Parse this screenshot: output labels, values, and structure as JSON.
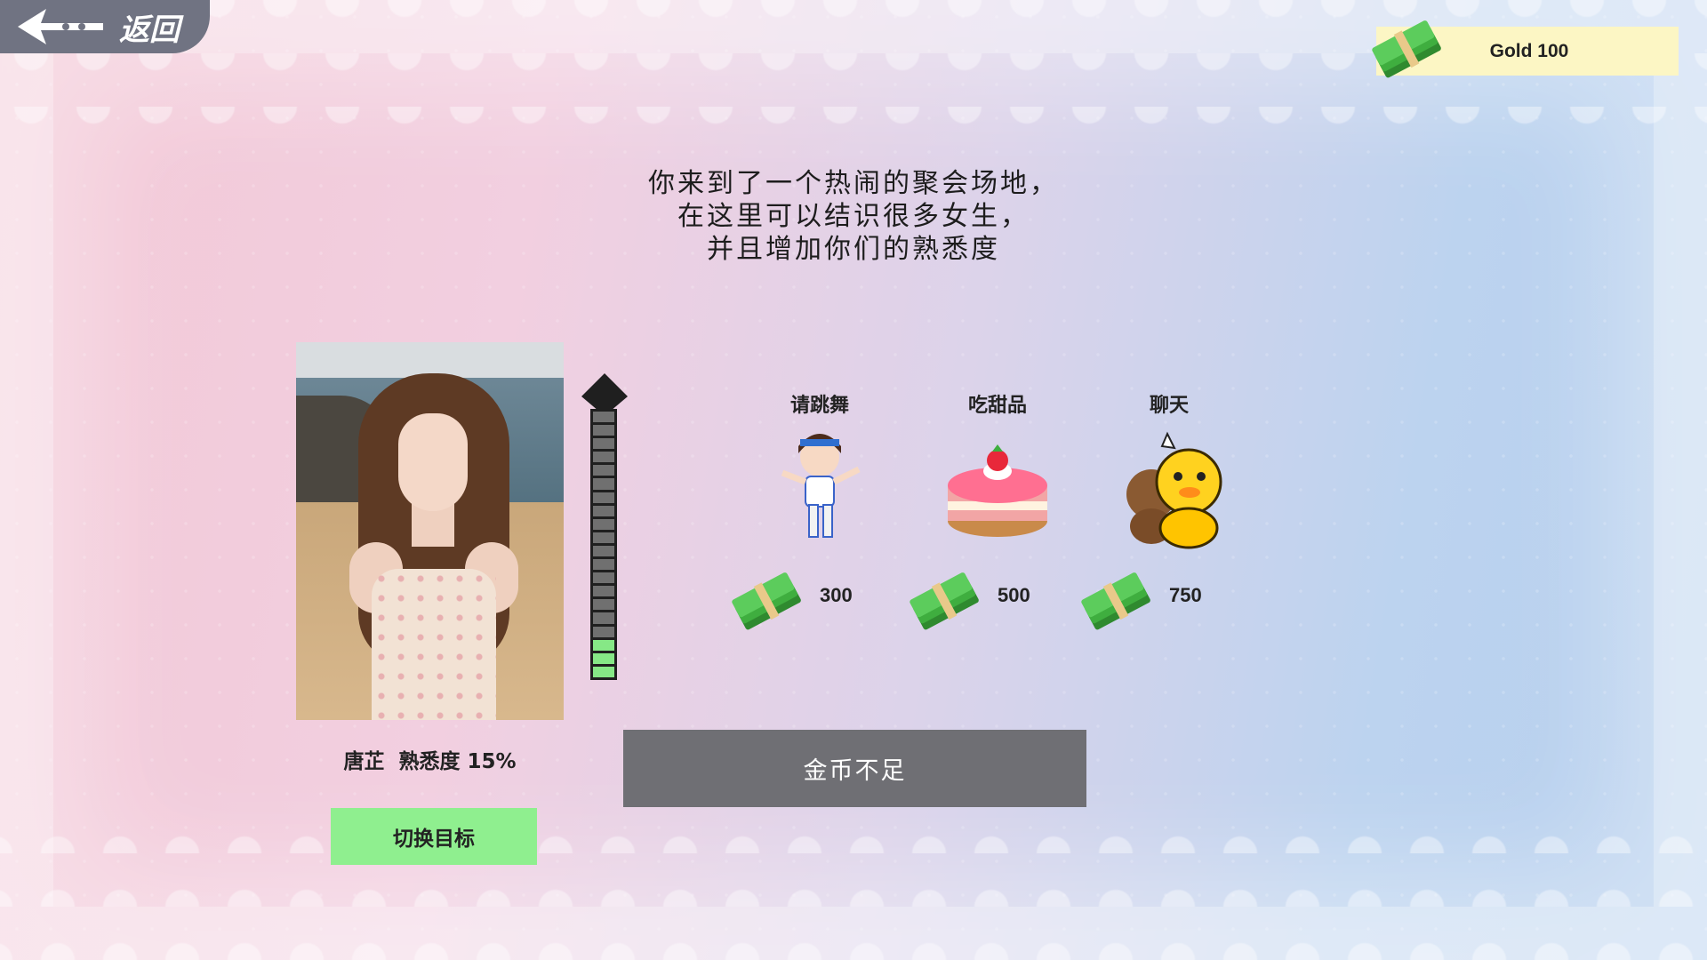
{
  "nav": {
    "back_label": "返回",
    "back_icon": "arrow-left-icon"
  },
  "currency": {
    "label": "Gold 100",
    "icon": "cash-stack-icon"
  },
  "intro_lines": [
    "你来到了一个热闹的聚会场地，",
    "在这里可以结识很多女生，",
    "并且增加你们的熟悉度"
  ],
  "target": {
    "name": "唐芷",
    "familiarity_label": "熟悉度 15%",
    "familiarity_value": 0.15,
    "switch_label": "切换目标"
  },
  "activities": [
    {
      "title": "请跳舞",
      "price": "300",
      "icon": "dancing-girl-icon"
    },
    {
      "title": "吃甜品",
      "price": "500",
      "icon": "strawberry-cake-icon"
    },
    {
      "title": "聊天",
      "price": "750",
      "icon": "chatting-chicks-icon"
    }
  ],
  "status": {
    "message": "金币不足"
  },
  "colors": {
    "switch_button": "#8fef8f",
    "meter_fill": "#86e886",
    "status_bar": "#6f6f74",
    "gold_panel": "#fcf6c4"
  }
}
